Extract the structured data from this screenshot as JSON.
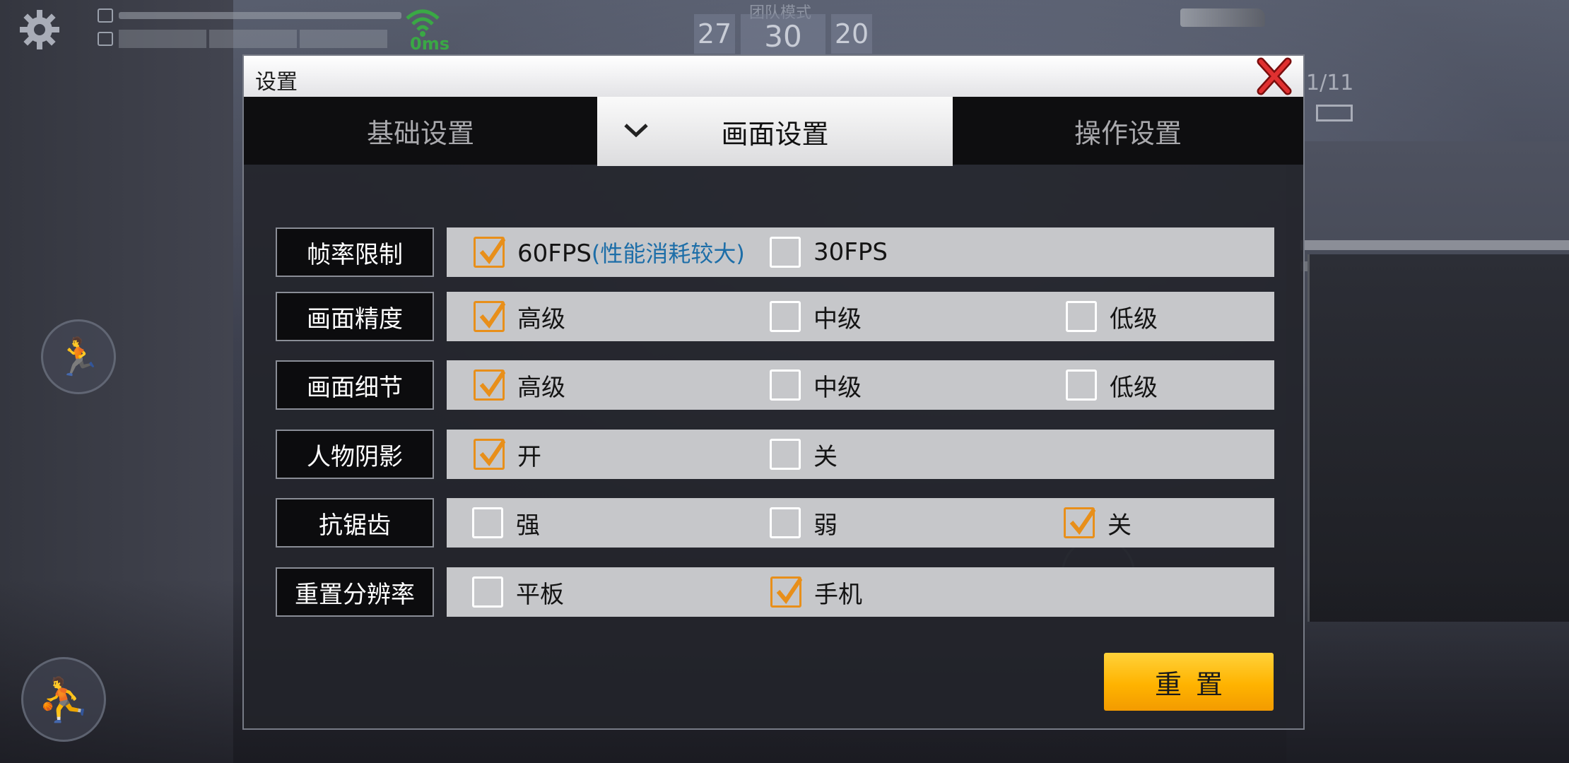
{
  "hud": {
    "ping": "0ms",
    "mode": "团队模式",
    "score_left": "27",
    "score_center": "30",
    "score_right": "20",
    "ammo": "1/11"
  },
  "dialog": {
    "title": "设置",
    "close_icon": "close-x-icon",
    "tabs": [
      {
        "label": "基础设置",
        "active": false
      },
      {
        "label": "画面设置",
        "active": true
      },
      {
        "label": "操作设置",
        "active": false
      }
    ],
    "rows": [
      {
        "label": "帧率限制",
        "options": [
          {
            "text": "60FPS",
            "note": "(性能消耗较大)",
            "checked": true
          },
          {
            "text": "30FPS",
            "checked": false
          }
        ]
      },
      {
        "label": "画面精度",
        "options": [
          {
            "text": "高级",
            "checked": true
          },
          {
            "text": "中级",
            "checked": false
          },
          {
            "text": "低级",
            "checked": false
          }
        ]
      },
      {
        "label": "画面细节",
        "options": [
          {
            "text": "高级",
            "checked": true
          },
          {
            "text": "中级",
            "checked": false
          },
          {
            "text": "低级",
            "checked": false
          }
        ]
      },
      {
        "label": "人物阴影",
        "options": [
          {
            "text": "开",
            "checked": true
          },
          {
            "text": "关",
            "checked": false
          }
        ]
      },
      {
        "label": "抗锯齿",
        "options": [
          {
            "text": "强",
            "checked": false
          },
          {
            "text": "弱",
            "checked": false
          },
          {
            "text": "关",
            "checked": true
          }
        ]
      },
      {
        "label": "重置分辨率",
        "options": [
          {
            "text": "平板",
            "checked": false
          },
          {
            "text": "手机",
            "checked": true
          }
        ]
      }
    ],
    "reset_label": "重置"
  },
  "colors": {
    "accent_orange": "#e88f1a",
    "button_yellow": "#ffb300",
    "note_blue": "#1d6ea8"
  }
}
